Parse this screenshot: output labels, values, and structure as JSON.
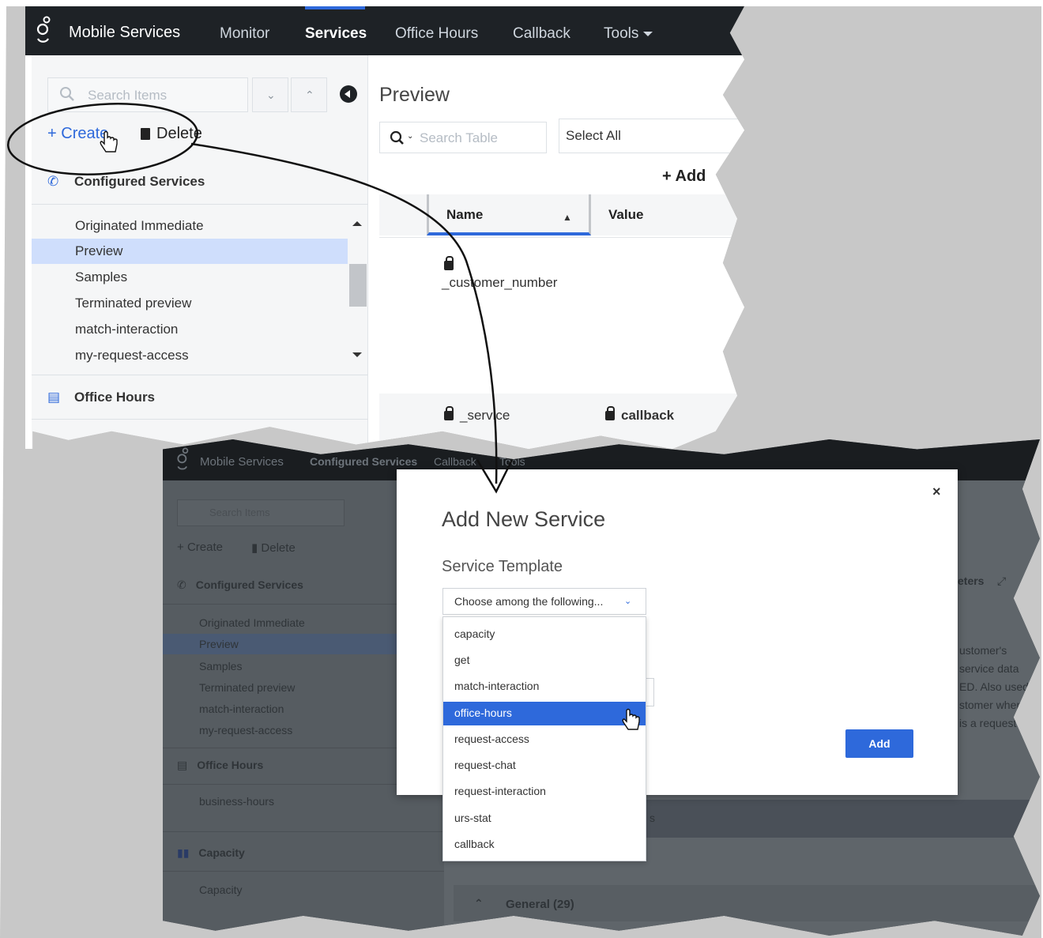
{
  "colors": {
    "accent": "#2e69db",
    "nav_bg": "#1e2226",
    "selected_row": "#cfdefc",
    "backdrop": "#c8c8c8",
    "overlay": "#4b5156"
  },
  "top": {
    "brand": "Mobile Services",
    "nav": [
      "Monitor",
      "Services",
      "Office Hours",
      "Callback",
      "Tools"
    ],
    "active_nav": "Services",
    "search_placeholder": "Search Items",
    "create_label": "Create",
    "delete_label": "Delete",
    "section_configured": "Configured Services",
    "services": [
      "Originated Immediate",
      "Preview",
      "Samples",
      "Terminated preview",
      "match-interaction",
      "my-request-access"
    ],
    "selected_service": "Preview",
    "section_office_hours": "Office Hours",
    "preview_title": "Preview",
    "table_search_placeholder": "Search Table",
    "select_all": "Select All",
    "add_label": "Add",
    "col_name": "Name",
    "col_value": "Value",
    "row1_name": "_customer_number",
    "row2_name": "_service",
    "row2_value": "callback",
    "icons": {
      "logo": "genesys-logo-icon",
      "search": "search-icon",
      "chevron_down": "chevron-down-icon",
      "chevron_up": "chevron-up-icon",
      "collapse": "collapse-left-icon",
      "plus": "plus-icon",
      "trash": "trash-icon",
      "phone": "phone-icon",
      "calendar": "calendar-icon",
      "lock": "lock-icon",
      "sort": "sort-icon"
    }
  },
  "bottom": {
    "brand": "Mobile Services",
    "nav": [
      "Configured Services",
      "Callback",
      "Tools"
    ],
    "search_placeholder": "Search Items",
    "create_label": "Create",
    "delete_label": "Delete",
    "section_configured": "Configured Services",
    "services": [
      "Originated Immediate",
      "Preview",
      "Samples",
      "Terminated preview",
      "match-interaction",
      "my-request-access"
    ],
    "section_office_hours": "Office Hours",
    "office_hours_items": [
      "business-hours"
    ],
    "section_capacity": "Capacity",
    "capacity_items": [
      "Capacity"
    ],
    "right_fragments": [
      "eters",
      "ustomer's",
      "service data",
      "ED. Also used",
      "stomer when",
      "is a request p",
      "s",
      "General (29)"
    ]
  },
  "modal": {
    "title": "Add New Service",
    "close": "×",
    "template_label": "Service Template",
    "select_placeholder": "Choose among the following...",
    "options": [
      "capacity",
      "get",
      "match-interaction",
      "office-hours",
      "request-access",
      "request-chat",
      "request-interaction",
      "urs-stat",
      "callback"
    ],
    "highlighted_option": "office-hours",
    "add_button": "Add"
  }
}
